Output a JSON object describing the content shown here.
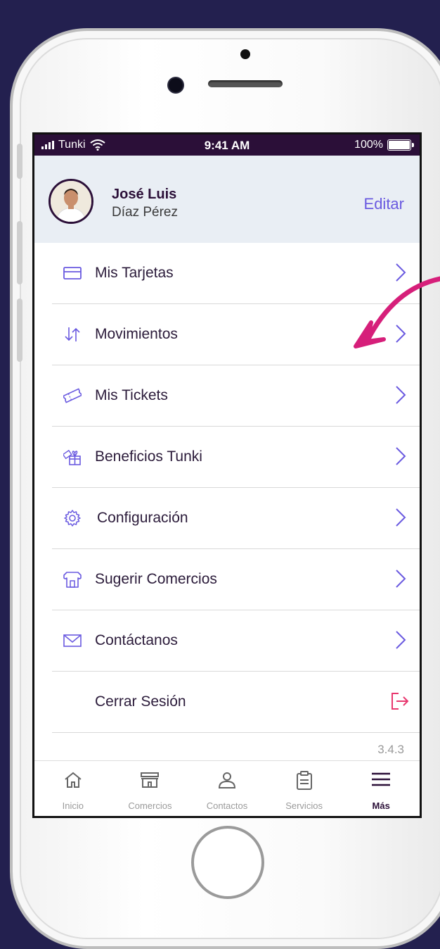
{
  "status_bar": {
    "carrier": "Tunki",
    "time": "9:41 AM",
    "battery": "100%"
  },
  "profile": {
    "first_name": "José Luis",
    "last_name": "Díaz Pérez",
    "edit_label": "Editar"
  },
  "menu": {
    "items": [
      {
        "label": "Mis Tarjetas",
        "icon": "credit-card-icon"
      },
      {
        "label": "Movimientos",
        "icon": "transfer-arrows-icon"
      },
      {
        "label": "Mis Tickets",
        "icon": "ticket-icon"
      },
      {
        "label": "Beneficios Tunki",
        "icon": "gift-icon"
      },
      {
        "label": "Configuración",
        "icon": "gear-icon"
      },
      {
        "label": "Sugerir Comercios",
        "icon": "store-icon"
      },
      {
        "label": "Contáctanos",
        "icon": "envelope-icon"
      }
    ],
    "logout_label": "Cerrar Sesión",
    "version": "3.4.3"
  },
  "tabs": [
    {
      "label": "Inicio",
      "icon": "home-icon"
    },
    {
      "label": "Comercios",
      "icon": "store-icon"
    },
    {
      "label": "Contactos",
      "icon": "person-icon"
    },
    {
      "label": "Servicios",
      "icon": "clipboard-icon"
    },
    {
      "label": "Más",
      "icon": "menu-icon",
      "active": true
    }
  ],
  "colors": {
    "status_bar": "#2b0f38",
    "accent": "#6a5ae0",
    "logout": "#e8386f",
    "annotation_arrow": "#d61f7a"
  }
}
